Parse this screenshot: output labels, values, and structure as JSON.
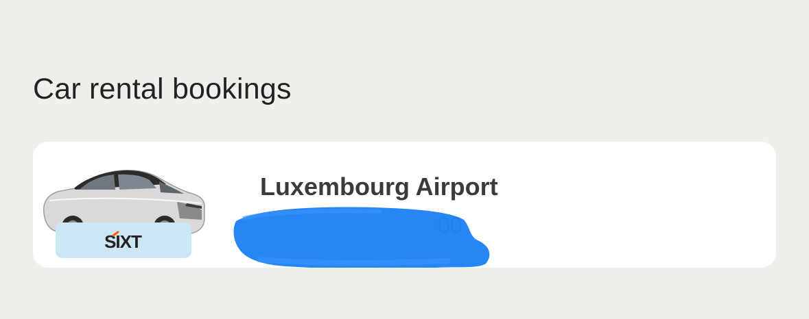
{
  "section": {
    "title": "Car rental bookings"
  },
  "booking": {
    "location": "Luxembourg Airport",
    "date_time": "00",
    "brand": "SIXT",
    "colors": {
      "brand_orange": "#ff5f00",
      "badge_bg": "#cbe6f4",
      "redaction_blue": "#1a7ff5"
    },
    "icons": {
      "car": "car-photo",
      "logo": "sixt-logo"
    }
  }
}
